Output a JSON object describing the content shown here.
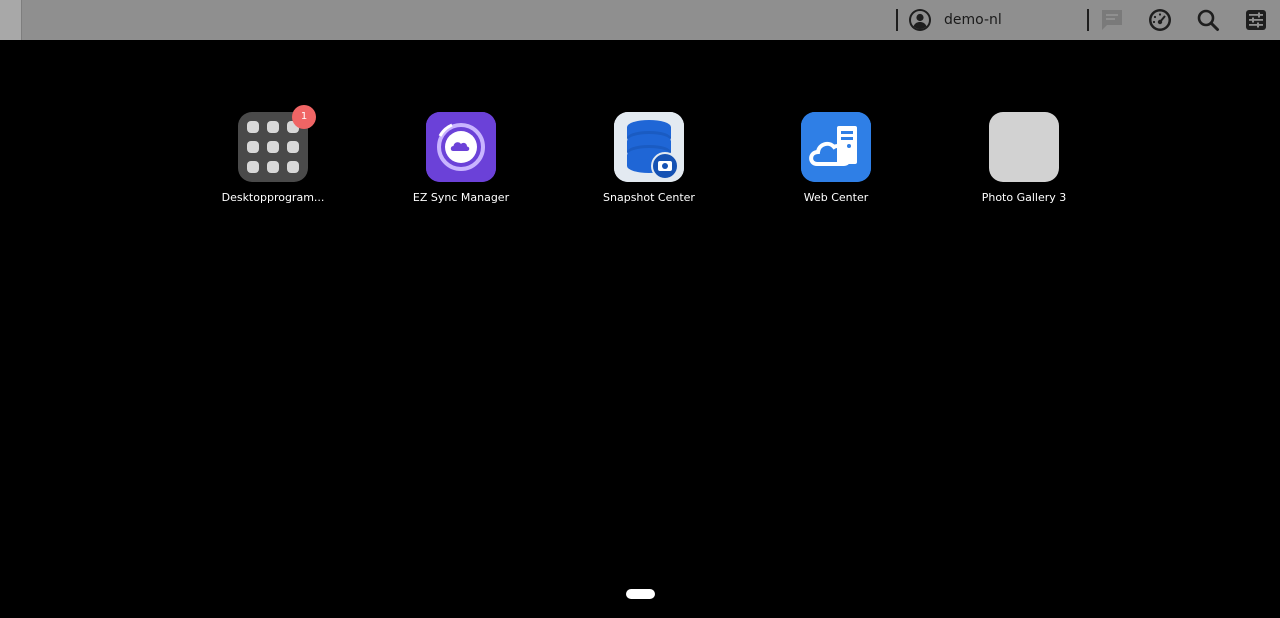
{
  "taskbar": {
    "username": "demo-nl",
    "icons": [
      "user-icon",
      "notifications-icon",
      "dashboard-icon",
      "search-icon",
      "options-icon"
    ],
    "colors": {
      "background": "#8f8f8f",
      "icon": "#1e1e1e"
    }
  },
  "desktop": {
    "apps": [
      {
        "label": "Desktopprogram...",
        "icon": "app-grid-icon",
        "badge": "1",
        "color": "#4a4a4a"
      },
      {
        "label": "EZ Sync Manager",
        "icon": "ez-sync-icon",
        "color": "#6a3fd6"
      },
      {
        "label": "Snapshot Center",
        "icon": "snapshot-icon",
        "color": "#dfe7ef"
      },
      {
        "label": "Web Center",
        "icon": "web-center-icon",
        "color": "#2f7fe6"
      },
      {
        "label": "Photo Gallery 3",
        "icon": "photo-gallery-icon",
        "color": "#d2d2d2"
      }
    ],
    "page_indicator": {
      "current": 1,
      "total": 1
    }
  }
}
